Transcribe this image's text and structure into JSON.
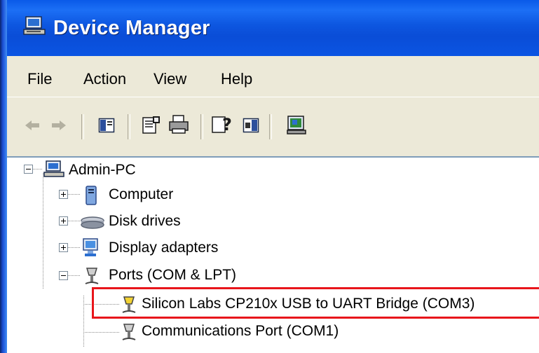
{
  "window": {
    "title": "Device Manager",
    "icon": "computer-icon"
  },
  "menubar": {
    "items": [
      "File",
      "Action",
      "View",
      "Help"
    ]
  },
  "toolbar": {
    "buttons": [
      "back-arrow-icon",
      "forward-arrow-icon",
      "show-hide-console-tree-icon",
      "properties-icon",
      "print-icon",
      "help-icon",
      "show-hide-action-pane-icon",
      "scan-hardware-icon"
    ]
  },
  "tree": {
    "root": {
      "label": "Admin-PC",
      "icon": "computer-icon",
      "expanded": true
    },
    "nodes": [
      {
        "label": "Computer",
        "icon": "computer-icon",
        "expanded": false
      },
      {
        "label": "Disk drives",
        "icon": "disk-drive-icon",
        "expanded": false
      },
      {
        "label": "Display adapters",
        "icon": "display-adapter-icon",
        "expanded": false
      },
      {
        "label": "Ports (COM & LPT)",
        "icon": "port-icon",
        "expanded": true,
        "children": [
          {
            "label": "Silicon Labs CP210x USB to UART Bridge (COM3)",
            "icon": "port-icon",
            "highlighted": true
          },
          {
            "label": "Communications Port (COM1)",
            "icon": "port-icon"
          }
        ]
      }
    ]
  },
  "colors": {
    "titlebar": "#0a56e0",
    "chrome": "#ece9d8",
    "highlight_box": "#e8151b"
  }
}
